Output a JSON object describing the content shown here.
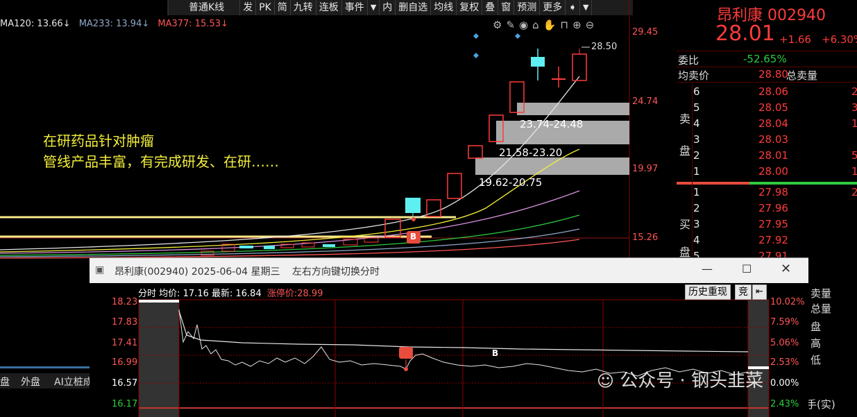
{
  "toolbar": {
    "items": [
      "普通K线",
      "发",
      "PK",
      "简",
      "九转",
      "连板",
      "事件",
      "内",
      "删自选",
      "均线",
      "复权",
      "叠",
      "窗",
      "预测",
      "更多"
    ]
  },
  "ma": {
    "ma120": "MA120: 13.66↓",
    "ma233": "MA233: 13.94↓",
    "ma377": "MA377: 15.53↓"
  },
  "price_axis": [
    "29.45",
    "24.74",
    "19.97",
    "15.26"
  ],
  "chart_labels": {
    "high_mark": "28.50",
    "zone1": "23.74-24.48",
    "zone2": "21.58-23.20",
    "zone3": "19.62-20.75",
    "buy_marker": "B"
  },
  "note": {
    "line1": "在研药品针对肿瘤",
    "line2": "管线产品丰富，有完成研发、在研……"
  },
  "stock": {
    "name_code": "昂利康 002940",
    "price": "28.01",
    "change": "+1.66",
    "change_pct": "+6.30%",
    "weibi_label": "委比",
    "weibi_value": "-52.65%",
    "avg_label": "均卖价",
    "avg_value": "28.80",
    "total_label": "总卖量",
    "sell_label_1": "卖",
    "sell_label_2": "盘",
    "buy_label_1": "买",
    "buy_label_2": "盘"
  },
  "sell_orders": [
    {
      "level": "6",
      "price": "28.06",
      "vol": "2"
    },
    {
      "level": "5",
      "price": "28.05",
      "vol": "3"
    },
    {
      "level": "4",
      "price": "28.04",
      "vol": "1"
    },
    {
      "level": "3",
      "price": "28.03",
      "vol": ""
    },
    {
      "level": "2",
      "price": "28.01",
      "vol": "5"
    },
    {
      "level": "1",
      "price": "28.00",
      "vol": "1"
    }
  ],
  "buy_orders": [
    {
      "level": "1",
      "price": "27.98",
      "vol": "2"
    },
    {
      "level": "2",
      "price": "27.96",
      "vol": ""
    },
    {
      "level": "3",
      "price": "27.95",
      "vol": ""
    },
    {
      "level": "4",
      "price": "27.92",
      "vol": ""
    },
    {
      "level": "5",
      "price": "27.91",
      "vol": ""
    }
  ],
  "bottom_left": {
    "tab1": "盘",
    "tab2": "外盘",
    "tab3": "AI立桩成"
  },
  "mini": {
    "title": "昂利康(002940) 2025-06-04 星期三",
    "hint": "左右方向键切换分时",
    "status": "分时 均价: 17.16 最新: 16.84",
    "limit": "涨停价:28.99",
    "btn_history": "历史重现",
    "btn_auction": "竞",
    "y_left": [
      "18.23",
      "17.83",
      "17.41",
      "16.99",
      "16.57",
      "16.17"
    ],
    "y_right": [
      "10.02%",
      "7.59%",
      "5.06%",
      "2.53%",
      "0.00%",
      "2.43%"
    ],
    "buy_marker": "B"
  },
  "right_side_labels": [
    "卖量",
    "总量",
    "盘",
    "高",
    "低",
    "手(实)"
  ],
  "watermark": "公众号 · 钢头韭菜",
  "colors": {
    "up": "#ff3b3b",
    "down": "#5ef0f0",
    "yellow": "#f2ee3a",
    "green": "#2ecc40"
  }
}
